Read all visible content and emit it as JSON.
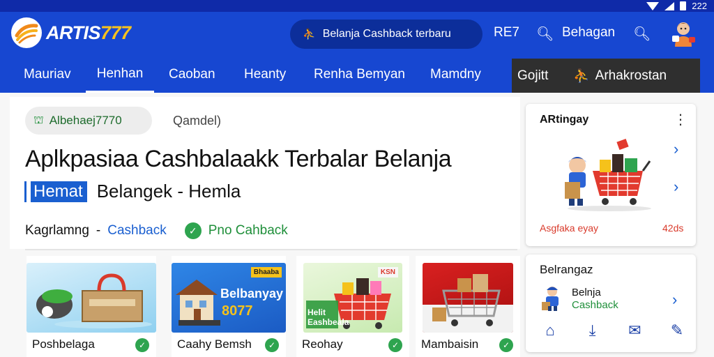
{
  "status_bar": {
    "time": "222",
    "icons": [
      "wifi-icon",
      "signal-icon",
      "battery-icon"
    ]
  },
  "header": {
    "logo_word": "ARTIS",
    "logo_number": "777",
    "search_pill_text": "Belanja Cashback terbaru",
    "code_label": "RE7",
    "belanja_label": "Behagan",
    "icons": [
      "search-icon",
      "user-avatar-icon"
    ]
  },
  "nav": {
    "items": [
      "Mauriav",
      "Henhan",
      "Caoban",
      "Heanty",
      "Renha Bemyan",
      "Mamdny"
    ],
    "active_index": 1,
    "dark_left": "Gojitt",
    "dark_right": "Arhakrostan"
  },
  "hero": {
    "chip_label": "Albehaej7770",
    "sub_link": "Qamdel)",
    "headline": "Aplkpasiaa Cashbalaakk Terbalar Belanja",
    "badge": "Hemat",
    "badge_sub": "Belangek - Hemla",
    "info_key": "Kagrlamng",
    "info_dash": "-",
    "info_cashback": "Cashback",
    "info_promo": "Pno Cahback"
  },
  "side_card": {
    "title": "ARtingay",
    "footer_left": "Asgfaka eyay",
    "footer_right": "42ds"
  },
  "mini_card": {
    "title": "Belrangaz",
    "name": "Belnja",
    "sub": "Cashback",
    "icons": [
      "home-icon",
      "download-icon",
      "mail-icon",
      "edit-icon"
    ]
  },
  "products": [
    {
      "label": "Poshbelaga",
      "tag": ""
    },
    {
      "label": "Caahy Bemsh",
      "tag": "Bhaaba",
      "art_text": "Belbanyay",
      "art_num": "8077"
    },
    {
      "label": "Reohay",
      "tag": "KSN",
      "art_text": "Helit Eashbeala"
    },
    {
      "label": "Mambaisin",
      "tag": ""
    }
  ],
  "colors": {
    "primary": "#1747d1",
    "statusbar": "#0f2aa8",
    "accent_yellow": "#f7c21c",
    "success": "#2ea44f",
    "link": "#1a5fd0",
    "danger": "#d93a2b"
  }
}
